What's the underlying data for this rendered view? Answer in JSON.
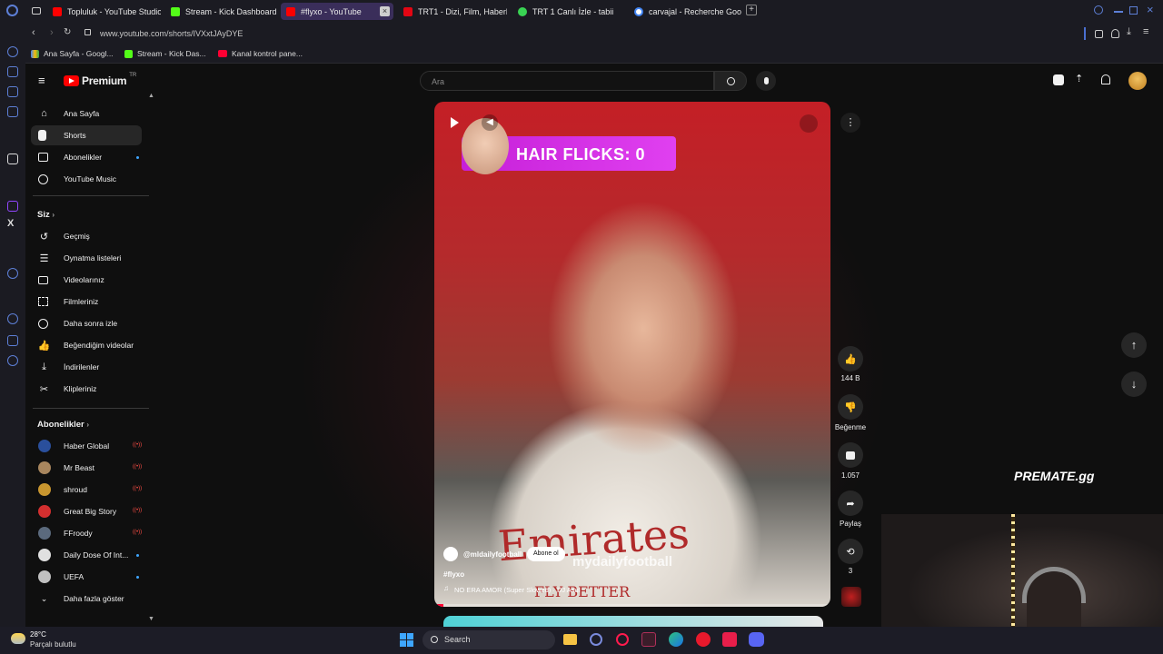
{
  "tabs": [
    {
      "label": "Topluluk - YouTube Studio",
      "color": "#ff0000"
    },
    {
      "label": "Stream - Kick Dashboard",
      "color": "#53fc18"
    },
    {
      "label": "#flyxo - YouTube",
      "color": "#ff0000"
    },
    {
      "label": "TRT1 - Dizi, Film, Haberle",
      "color": "#e30613"
    },
    {
      "label": "TRT 1 Canlı İzle - tabii",
      "color": "#39d353"
    },
    {
      "label": "carvajal - Recherche Goo",
      "color": "#4285f4"
    }
  ],
  "address": {
    "url": "www.youtube.com/shorts/IVXxtJAyDYE"
  },
  "bookmarks": [
    {
      "label": "Ana Sayfa - Googl..."
    },
    {
      "label": "Stream - Kick Das..."
    },
    {
      "label": "Kanal kontrol pane..."
    }
  ],
  "yt": {
    "logo_text": "Premium",
    "logo_sup": "TR",
    "search_placeholder": "Ara",
    "nav_main": [
      {
        "label": "Ana Sayfa",
        "icon": "home-icon"
      },
      {
        "label": "Shorts",
        "icon": "shorts-icon"
      },
      {
        "label": "Abonelikler",
        "icon": "subscriptions-icon"
      },
      {
        "label": "YouTube Music",
        "icon": "music-icon"
      }
    ],
    "you_heading": "Siz",
    "nav_you": [
      {
        "label": "Geçmiş",
        "icon": "history-icon"
      },
      {
        "label": "Oynatma listeleri",
        "icon": "playlist-icon"
      },
      {
        "label": "Videolarınız",
        "icon": "video-icon"
      },
      {
        "label": "Filmleriniz",
        "icon": "film-icon"
      },
      {
        "label": "Daha sonra izle",
        "icon": "clock-icon"
      },
      {
        "label": "Beğendiğim videolar",
        "icon": "thumb-up-icon"
      },
      {
        "label": "İndirilenler",
        "icon": "download-icon"
      },
      {
        "label": "Klipleriniz",
        "icon": "scissors-icon"
      }
    ],
    "subs_heading": "Abonelikler",
    "subs": [
      {
        "label": "Haber Global",
        "color": "#2a4f9c",
        "status": "live"
      },
      {
        "label": "Mr Beast",
        "color": "#a8865e",
        "status": "live"
      },
      {
        "label": "shroud",
        "color": "#c9962f",
        "status": "live"
      },
      {
        "label": "Great Big Story",
        "color": "#d32f2f",
        "status": "live"
      },
      {
        "label": "FFroody",
        "color": "#5b6a7d",
        "status": "live"
      },
      {
        "label": "Daily Dose Of Int...",
        "color": "#e0e0e0",
        "status": "new"
      },
      {
        "label": "UEFA",
        "color": "#c0c0c0",
        "status": "new"
      }
    ],
    "show_more": "Daha fazla göster",
    "short": {
      "overlay_title": "HAIR FLICKS: 0",
      "channel": "@mldailyfootball",
      "subscribe": "Abone ol",
      "hashtag": "#flyxo",
      "music": "NO ERA AMOR (Super Slowed) · DJ Asul",
      "watermark": "mydailyfootball",
      "shirt_text": "Emirates",
      "shirt_sub": "FLY BETTER"
    },
    "actions": {
      "likes": "144 B",
      "dislike": "Beğenme",
      "comments": "1.057",
      "share": "Paylaş",
      "remix": "3"
    }
  },
  "overlay_brand": "PREMATE.gg",
  "taskbar": {
    "temp": "28°C",
    "weather": "Parçalı bulutlu",
    "search": "Search"
  }
}
